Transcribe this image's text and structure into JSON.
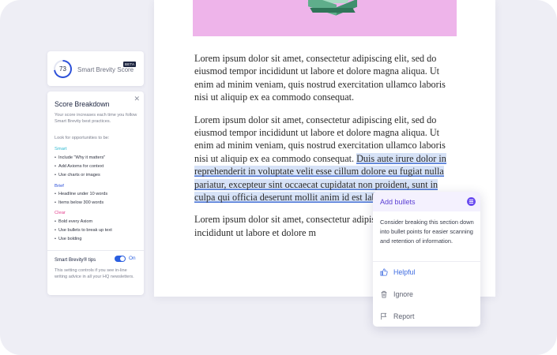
{
  "score": {
    "value": "73",
    "value_percent": 73,
    "beta_label": "BETA",
    "title": "Smart Brevity Score"
  },
  "breakdown": {
    "title": "Score Breakdown",
    "description": "Your score increases each time you follow Smart Brevity best practices.",
    "look_label": "Look for opportunities to be:",
    "categories": [
      {
        "label": "Smart",
        "color": "#2fb9d0",
        "items": [
          "Include \"Why it matters\"",
          "Add Axioms for context",
          "Use charts or images"
        ]
      },
      {
        "label": "Brief",
        "color": "#2b4fd8",
        "items": [
          "Headline under 10 words",
          "Items below 300 words"
        ]
      },
      {
        "label": "Clear",
        "color": "#e4428f",
        "items": [
          "Bold every Axiom",
          "Use bullets to break up text",
          "Use bolding"
        ]
      }
    ],
    "tips_label": "Smart Brevity® tips",
    "tips_toggle": "On",
    "tips_description": "This setting controls if you see in-line writing advice in all your HQ newsletters."
  },
  "document": {
    "paragraph_1": "Lorem ipsum dolor sit amet, consectetur adipiscing elit, sed do eiusmod tempor incididunt ut labore et dolore magna aliqua. Ut enim ad minim veniam, quis nostrud exercitation ullamco laboris nisi ut aliquip ex ea commodo consequat.",
    "paragraph_2_plain": "Lorem ipsum dolor sit amet, consectetur adipiscing elit, sed do eiusmod tempor incididunt ut labore et dolore magna aliqua. Ut enim ad minim veniam, quis nostrud exercitation ullamco laboris nisi ut aliquip ex ea commodo consequat. ",
    "paragraph_2_highlight": "Duis aute irure dolor in reprehenderit in voluptate velit esse cillum dolore eu fugiat nulla pariatur, excepteur sint occaecat cupidatat non proident, sunt in culpa qui officia deserunt mollit anim id est laborum.",
    "paragraph_3": "Lorem ipsum dolor sit amet, consectetur adipisc eiusmod tempor incididunt ut labore et dolore m"
  },
  "suggestion": {
    "title": "Add bullets",
    "body": "Consider breaking this section down into bullet points for easier scanning and retention of information.",
    "actions": [
      {
        "label": "Helpful",
        "icon": "thumbs-up-icon"
      },
      {
        "label": "Ignore",
        "icon": "trash-icon"
      },
      {
        "label": "Report",
        "icon": "flag-icon"
      }
    ],
    "accent": "#6a4cf0"
  }
}
